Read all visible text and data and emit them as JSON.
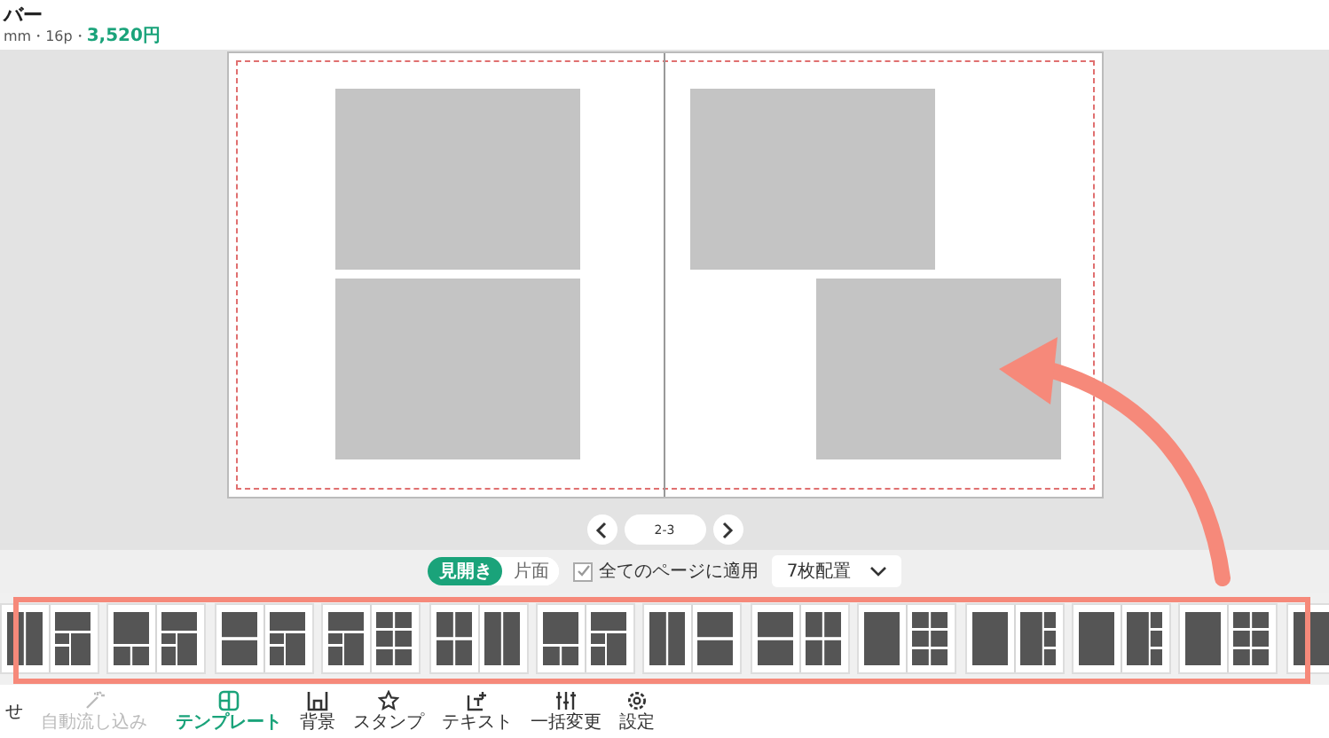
{
  "header": {
    "title": "バー",
    "specs": "mm・16p・",
    "price": "3,520円"
  },
  "spread": {
    "page_label": "2-3"
  },
  "view_modes": [
    {
      "label": "見開き",
      "selected": true
    },
    {
      "label": "片面",
      "selected": false
    }
  ],
  "apply_all": {
    "label": "全てのページに適用",
    "checked": true
  },
  "photo_count": {
    "value": "7枚配置"
  },
  "toolbar": [
    {
      "label": "せ",
      "kind": "none",
      "selected": false,
      "disabled": false
    },
    {
      "label": "自動流し込み",
      "kind": "magic",
      "selected": false,
      "disabled": true
    },
    {
      "label": "テンプレート",
      "kind": "template",
      "selected": true,
      "disabled": false
    },
    {
      "label": "背景",
      "kind": "background",
      "selected": false,
      "disabled": false
    },
    {
      "label": "スタンプ",
      "kind": "star",
      "selected": false,
      "disabled": false
    },
    {
      "label": "テキスト",
      "kind": "text",
      "selected": false,
      "disabled": false
    },
    {
      "label": "一括変更",
      "kind": "sliders",
      "selected": false,
      "disabled": false
    },
    {
      "label": "設定",
      "kind": "gear",
      "selected": false,
      "disabled": false
    }
  ]
}
